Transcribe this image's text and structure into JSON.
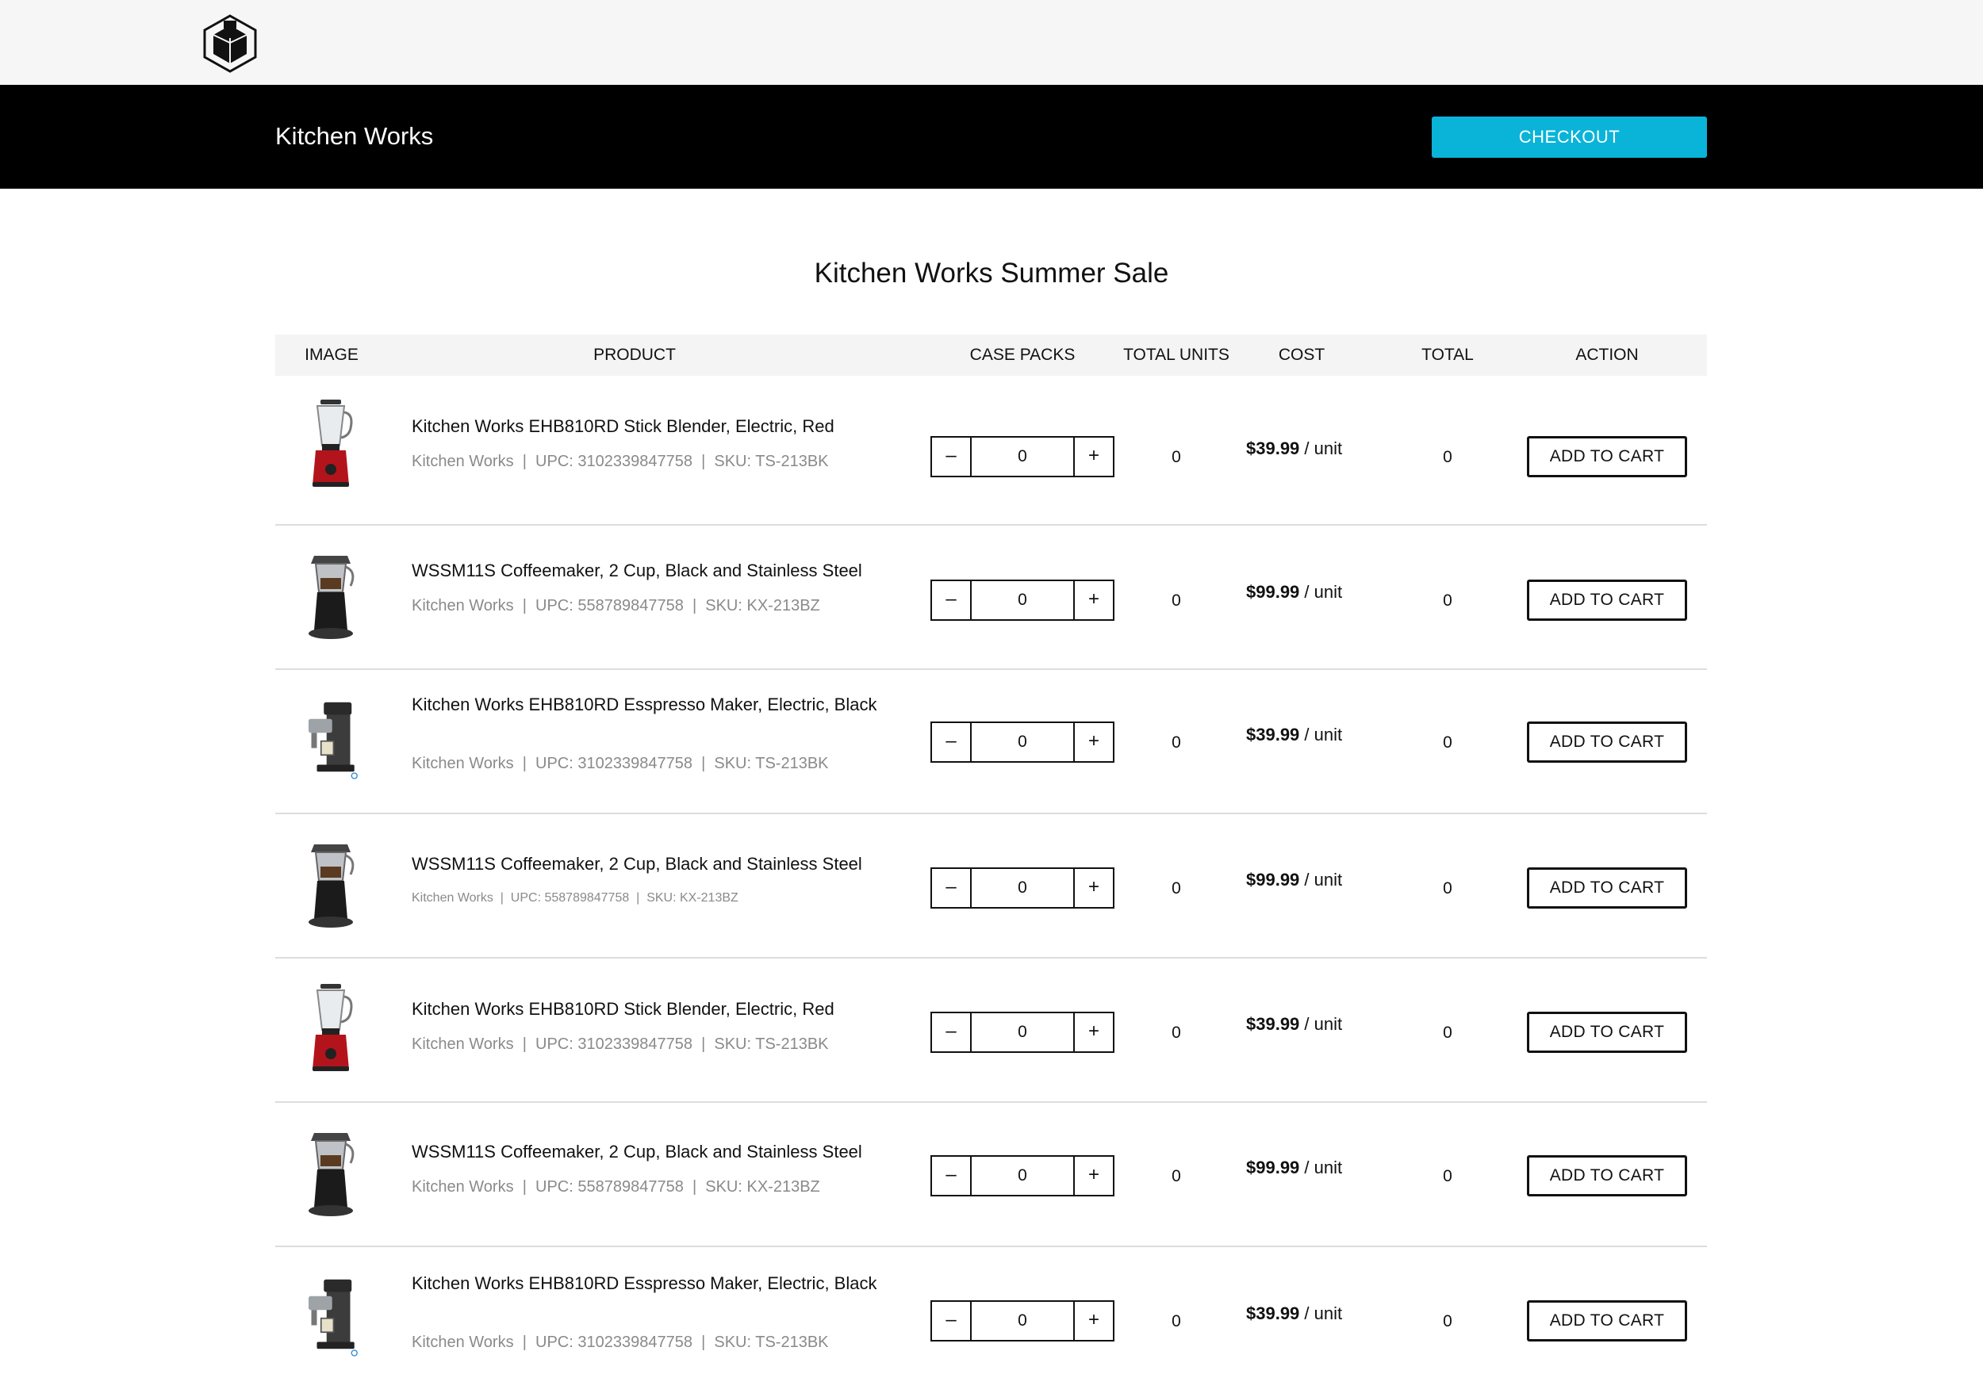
{
  "header": {
    "logo_icon": "building-cube-icon",
    "store_name": "Kitchen Works",
    "checkout_label": "CHECKOUT",
    "checkout_color": "#0ab4d8"
  },
  "page": {
    "title": "Kitchen Works Summer Sale"
  },
  "table": {
    "columns": [
      "IMAGE",
      "PRODUCT",
      "CASE PACKS",
      "TOTAL UNITS",
      "COST",
      "TOTAL",
      "ACTION"
    ],
    "rows": [
      {
        "image_icon": "blender-icon",
        "name": "Kitchen Works EHB810RD Stick Blender, Electric, Red",
        "brand": "Kitchen Works",
        "upc": "UPC: 3102339847758",
        "sku": "SKU: TS-213BK",
        "qty": "0",
        "total_units": "0",
        "price": "$39.99",
        "unit": " / unit",
        "total": "0",
        "action": "ADD TO CART"
      },
      {
        "image_icon": "coffeemaker-icon",
        "name": "WSSM11S Coffeemaker, 2 Cup, Black and Stainless Steel",
        "brand": "Kitchen Works",
        "upc": "UPC: 558789847758",
        "sku": "SKU: KX-213BZ",
        "qty": "0",
        "total_units": "0",
        "price": "$99.99",
        "unit": " / unit",
        "total": "0",
        "action": "ADD TO CART"
      },
      {
        "image_icon": "espresso-maker-icon",
        "name": "Kitchen Works EHB810RD Esspresso Maker, Electric, Black",
        "brand": "Kitchen Works",
        "upc": "UPC: 3102339847758",
        "sku": "SKU: TS-213BK",
        "qty": "0",
        "total_units": "0",
        "price": "$39.99",
        "unit": " / unit",
        "total": "0",
        "action": "ADD TO CART"
      },
      {
        "image_icon": "coffeemaker-icon",
        "name": "WSSM11S Coffeemaker, 2 Cup, Black and Stainless Steel",
        "brand": "Kitchen Works",
        "upc": "UPC: 558789847758",
        "sku": "SKU: KX-213BZ",
        "qty": "0",
        "total_units": "0",
        "price": "$99.99",
        "unit": " / unit",
        "total": "0",
        "action": "ADD TO CART"
      },
      {
        "image_icon": "blender-icon",
        "name": "Kitchen Works EHB810RD Stick Blender, Electric, Red",
        "brand": "Kitchen Works",
        "upc": "UPC: 3102339847758",
        "sku": "SKU: TS-213BK",
        "qty": "0",
        "total_units": "0",
        "price": "$39.99",
        "unit": " / unit",
        "total": "0",
        "action": "ADD TO CART"
      },
      {
        "image_icon": "coffeemaker-icon",
        "name": "WSSM11S Coffeemaker, 2 Cup, Black and Stainless Steel",
        "brand": "Kitchen Works",
        "upc": "UPC: 558789847758",
        "sku": "SKU: KX-213BZ",
        "qty": "0",
        "total_units": "0",
        "price": "$99.99",
        "unit": " / unit",
        "total": "0",
        "action": "ADD TO CART"
      },
      {
        "image_icon": "espresso-maker-icon",
        "name": "Kitchen Works EHB810RD Esspresso Maker, Electric, Black",
        "brand": "Kitchen Works",
        "upc": "UPC: 3102339847758",
        "sku": "SKU: TS-213BK",
        "qty": "0",
        "total_units": "0",
        "price": "$39.99",
        "unit": " / unit",
        "total": "0",
        "action": "ADD TO CART"
      }
    ],
    "minus_label": "–",
    "plus_label": "+"
  }
}
